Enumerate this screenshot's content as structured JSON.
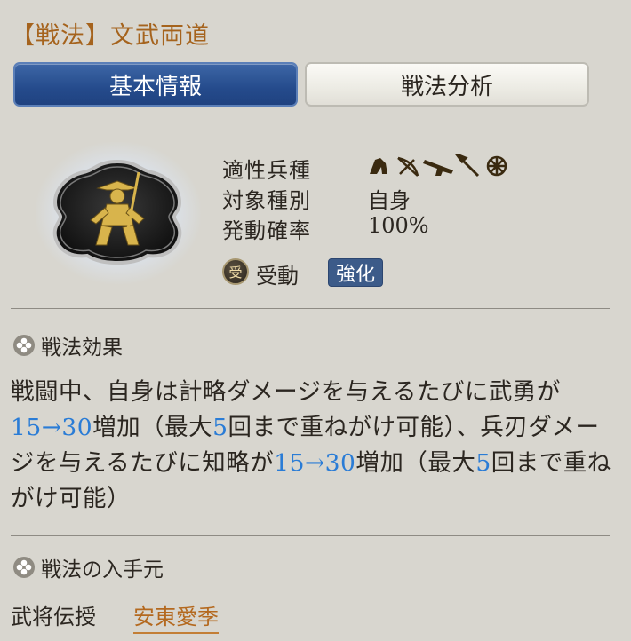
{
  "header": {
    "title": "【戦法】文武両道"
  },
  "tabs": [
    {
      "label": "基本情報",
      "active": true
    },
    {
      "label": "戦法分析",
      "active": false
    }
  ],
  "stats": {
    "unit_label": "適性兵種",
    "unit_icons": [
      "cavalry-icon",
      "bow-icon",
      "gun-icon",
      "spear-icon",
      "wheel-icon"
    ],
    "target_label": "対象種別",
    "target_value": "自身",
    "rate_label": "発動確率",
    "rate_value": "100%"
  },
  "tags": {
    "type_badge": "受",
    "type_label": "受動",
    "extra_label": "強化"
  },
  "effect_section": {
    "heading": "戦法効果",
    "text": [
      {
        "t": "戦闘中、自身は計略ダメージを与えるたびに武勇が"
      },
      {
        "t": "15→30",
        "hl": true
      },
      {
        "t": "増加（最大"
      },
      {
        "t": "5",
        "hl": true
      },
      {
        "t": "回まで重ねがけ可能）、兵刃ダメージを与えるたびに知略が"
      },
      {
        "t": "15→30",
        "hl": true
      },
      {
        "t": "増加（最大"
      },
      {
        "t": "5",
        "hl": true
      },
      {
        "t": "回まで重ねがけ可能）"
      }
    ]
  },
  "source_section": {
    "heading": "戦法の入手元",
    "label": "武将伝授",
    "link": "安東愛季"
  },
  "colors": {
    "accent": "#a5631d",
    "highlight": "#2a7cd6",
    "tab_active": "#254b8c",
    "pill": "#3c5b89",
    "background": "#d8d6cf"
  }
}
